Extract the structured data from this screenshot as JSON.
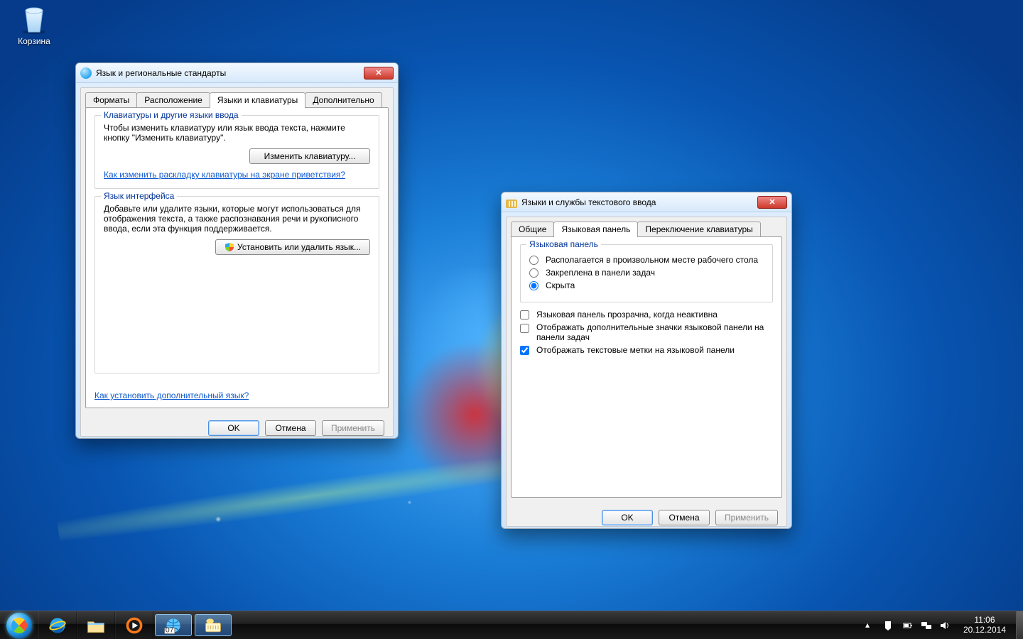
{
  "desktop": {
    "recycle_bin_label": "Корзина"
  },
  "dialog1": {
    "title": "Язык и региональные стандарты",
    "tabs": {
      "formats": "Форматы",
      "location": "Расположение",
      "keyboards": "Языки и клавиатуры",
      "advanced": "Дополнительно"
    },
    "grp_keyboards_legend": "Клавиатуры и другие языки ввода",
    "grp_keyboards_text": "Чтобы изменить клавиатуру или язык ввода текста, нажмите кнопку \"Изменить клавиатуру\".",
    "btn_change_keyboard": "Изменить клавиатуру...",
    "link_welcome_layout": "Как изменить раскладку клавиатуры на экране приветствия?",
    "grp_uilang_legend": "Язык интерфейса",
    "grp_uilang_text": "Добавьте или удалите языки, которые могут использоваться для отображения текста, а также распознавания речи и рукописного ввода, если эта функция поддерживается.",
    "btn_install_lang": "Установить или удалить язык...",
    "link_install_lang": "Как установить дополнительный язык?",
    "buttons": {
      "ok": "OK",
      "cancel": "Отмена",
      "apply": "Применить"
    }
  },
  "dialog2": {
    "title": "Языки и службы текстового ввода",
    "tabs": {
      "general": "Общие",
      "langbar": "Языковая панель",
      "switching": "Переключение клавиатуры"
    },
    "grp_langbar_legend": "Языковая панель",
    "radio_floating": "Располагается в произвольном месте рабочего стола",
    "radio_docked": "Закреплена в панели задач",
    "radio_hidden": "Скрыта",
    "chk_transparent": "Языковая панель прозрачна, когда неактивна",
    "chk_extra_icons": "Отображать дополнительные значки языковой панели на панели задач",
    "chk_text_labels": "Отображать текстовые метки на языковой панели",
    "buttons": {
      "ok": "OK",
      "cancel": "Отмена",
      "apply": "Применить"
    }
  },
  "taskbar": {
    "clock_time": "11:06",
    "clock_date": "20.12.2014"
  }
}
